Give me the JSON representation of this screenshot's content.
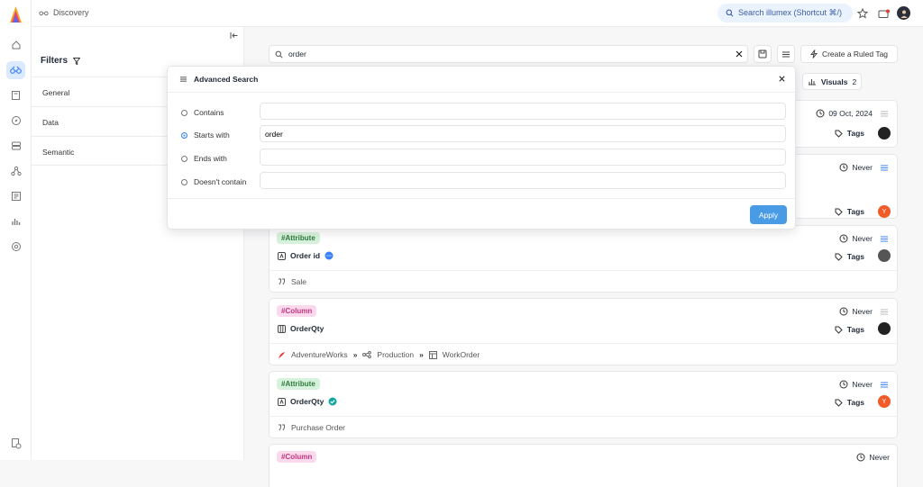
{
  "header": {
    "breadcrumb": "Discovery",
    "search_pill": "Search illumex (Shortcut ⌘/)"
  },
  "filters": {
    "title": "Filters",
    "sections": [
      "General",
      "Data",
      "Semantic"
    ]
  },
  "search": {
    "value": "order",
    "create_button": "Create a Ruled Tag",
    "visuals_label": "Visuals",
    "visuals_count": "2"
  },
  "advanced_search": {
    "title": "Advanced Search",
    "options": [
      {
        "label": "Contains",
        "value": "",
        "selected": false
      },
      {
        "label": "Starts with",
        "value": "order",
        "selected": true
      },
      {
        "label": "Ends with",
        "value": "",
        "selected": false
      },
      {
        "label": "Doesn't contain",
        "value": "",
        "selected": false
      }
    ],
    "apply_label": "Apply"
  },
  "cards": [
    {
      "date": "09 Oct, 2024",
      "tags_label": "Tags"
    },
    {
      "date": "Never",
      "tags_label": "Tags",
      "avatar_letter": "Y"
    },
    {
      "tag": "#Attribute",
      "name": "Order id",
      "date": "Never",
      "tags_label": "Tags",
      "footer": "Sale"
    },
    {
      "tag": "#Column",
      "name": "OrderQty",
      "date": "Never",
      "tags_label": "Tags",
      "path": [
        "AdventureWorks",
        "Production",
        "WorkOrder"
      ]
    },
    {
      "tag": "#Attribute",
      "name": "OrderQty",
      "date": "Never",
      "tags_label": "Tags",
      "avatar_letter": "Y",
      "footer": "Purchase Order"
    },
    {
      "tag": "#Column",
      "date": "Never"
    }
  ],
  "colors": {
    "accent": "#4a9be6",
    "attribute_tag": "#d7f2dc",
    "column_tag": "#fbd9ec",
    "avatar_orange": "#f15a29"
  },
  "icons": [
    "home-icon",
    "discovery-icon",
    "book-icon",
    "compass-icon",
    "database-icon",
    "graph-icon",
    "report-icon",
    "chart-icon",
    "settings-icon",
    "help-doc-icon",
    "star-icon",
    "mail-icon"
  ]
}
